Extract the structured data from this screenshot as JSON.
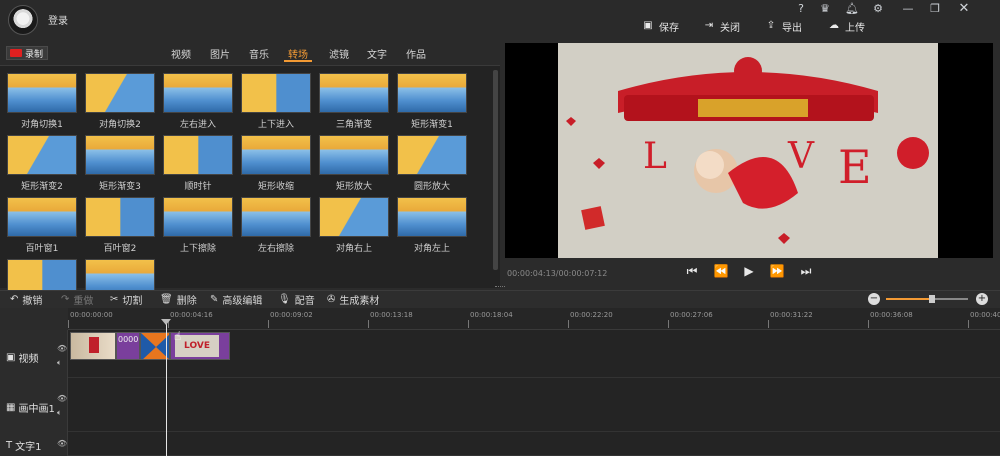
{
  "header": {
    "login_label": "登录",
    "save": "保存",
    "close": "关闭",
    "export": "导出",
    "upload": "上传",
    "help": "?"
  },
  "media": {
    "record_label": "录制",
    "tabs": [
      {
        "label": "视频"
      },
      {
        "label": "图片"
      },
      {
        "label": "音乐"
      },
      {
        "label": "转场"
      },
      {
        "label": "滤镜"
      },
      {
        "label": "文字"
      },
      {
        "label": "作品"
      }
    ],
    "active_tab": "转场",
    "transitions": [
      "对角切换1",
      "对角切换2",
      "左右进入",
      "上下进入",
      "三角渐变",
      "矩形渐变1",
      "矩形渐变2",
      "矩形渐变3",
      "顺时针",
      "矩形收缩",
      "矩形放大",
      "圆形放大",
      "百叶窗1",
      "百叶窗2",
      "上下擦除",
      "左右擦除",
      "对角右上",
      "对角左上",
      "",
      ""
    ]
  },
  "preview": {
    "time": "00:00:04:13/00:00:07:12"
  },
  "edit_toolbar": {
    "undo": "撤销",
    "redo": "重做",
    "cut": "切割",
    "delete": "删除",
    "advanced": "高级编辑",
    "voiceover": "配音",
    "generate": "生成素材"
  },
  "ruler": {
    "ticks": [
      "00:00:00:00",
      "00:00:04:16",
      "00:00:09:02",
      "00:00:13:18",
      "00:00:18:04",
      "00:00:22:20",
      "00:00:27:06",
      "00:00:31:22",
      "00:00:36:08",
      "00:00:40"
    ]
  },
  "tracks": [
    {
      "name": "视频",
      "icon": "video-track-icon"
    },
    {
      "name": "画中画1",
      "icon": "pip-track-icon"
    },
    {
      "name": "文字1",
      "icon": "text-track-icon"
    }
  ],
  "clips": {
    "clip2_label": "0000",
    "clip4_label": "LOVE"
  },
  "colors": {
    "accent": "#f39a34",
    "record": "#e02020",
    "clip_purple": "#7a3f9c",
    "transition_orange": "#e8761e"
  }
}
